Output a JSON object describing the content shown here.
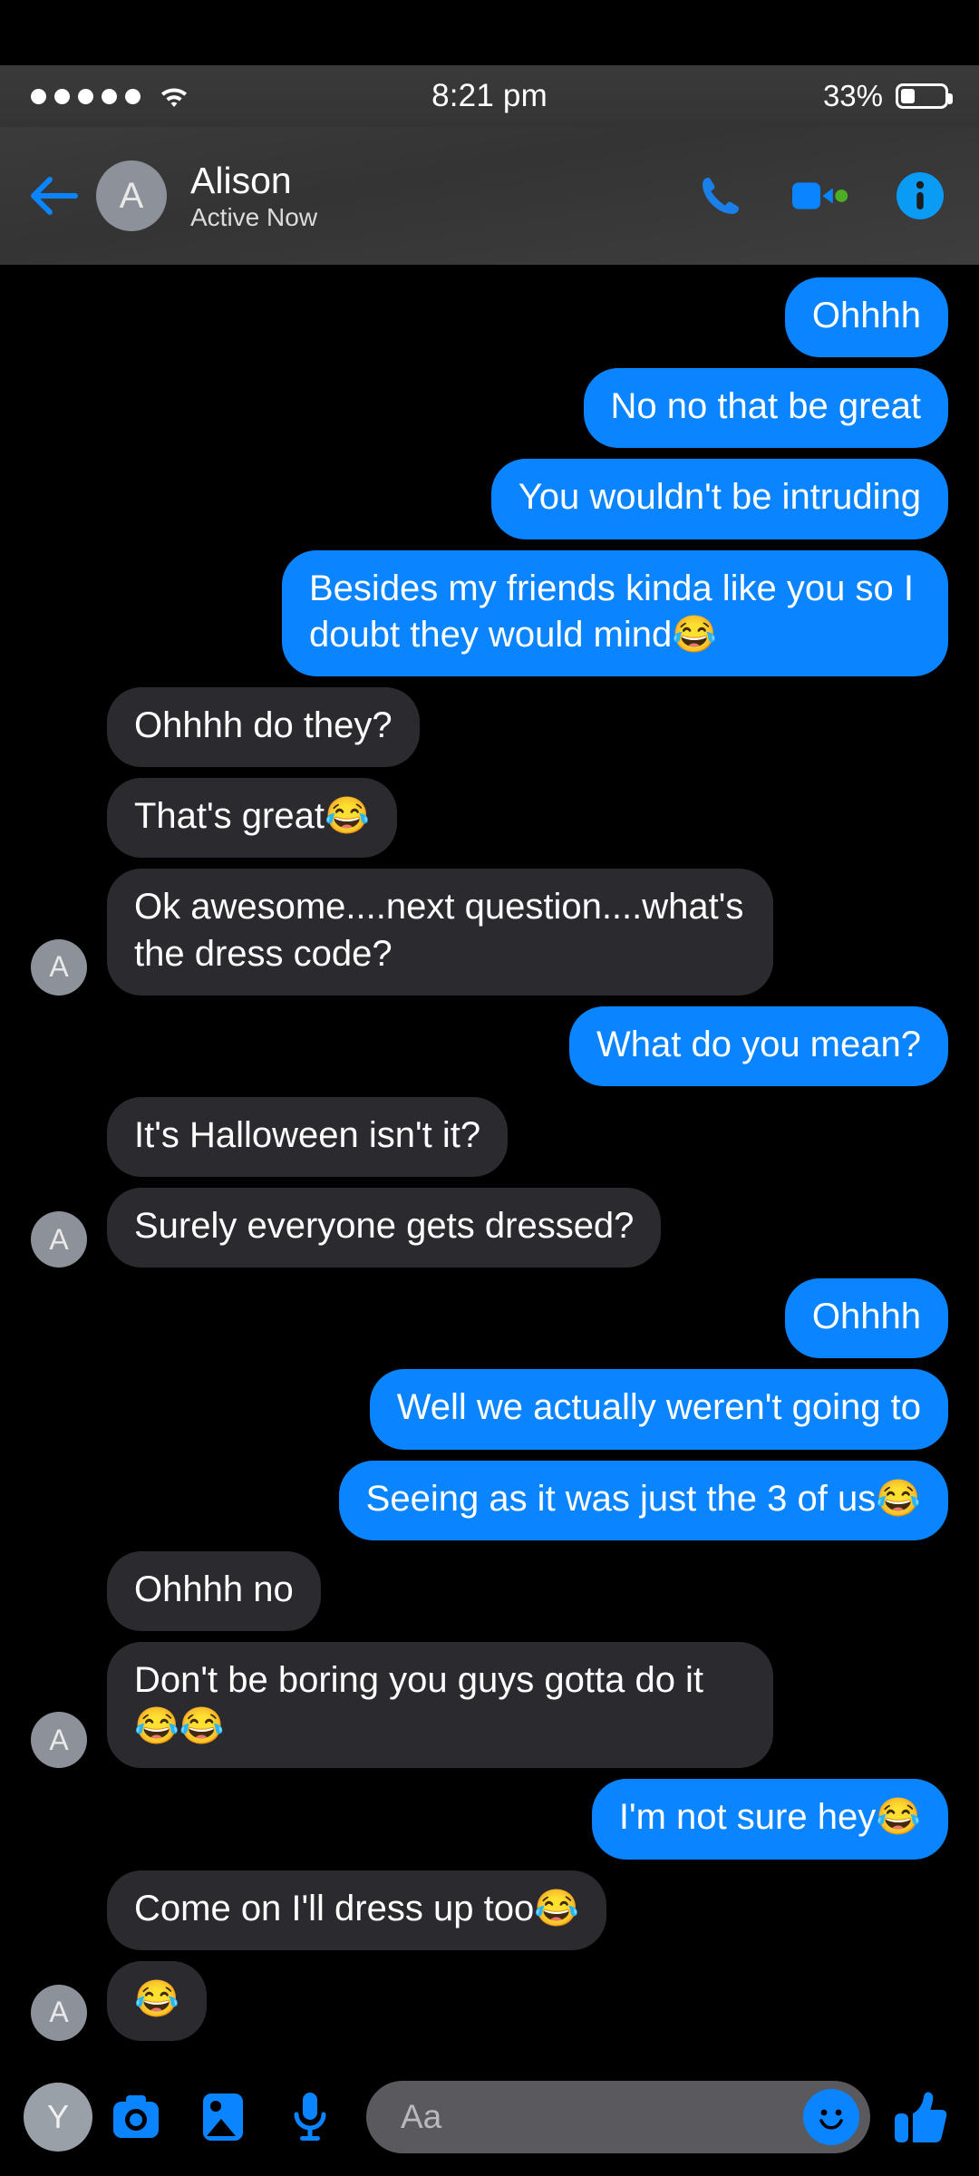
{
  "status_bar": {
    "signal_dots": 5,
    "wifi_icon": "wifi-icon",
    "time": "8:21 pm",
    "battery_percent": "33%",
    "battery_level": 33
  },
  "header": {
    "back_icon": "back-arrow-icon",
    "avatar_initial": "A",
    "title": "Alison",
    "subtitle": "Active Now",
    "actions": [
      {
        "name": "voice-call-icon",
        "label": "Voice call"
      },
      {
        "name": "video-call-icon",
        "label": "Video call"
      },
      {
        "name": "info-icon",
        "label": "Conversation info"
      }
    ],
    "active_dot_color": "#4caf23"
  },
  "colors": {
    "outgoing_bubble": "#0a84ff",
    "incoming_bubble": "#2b2b2f",
    "background": "#000000",
    "header_bg": "#3a3a3a",
    "avatar_bg": "#8d9199"
  },
  "messages": [
    {
      "side": "out",
      "text": "Ohhhh",
      "avatar": ""
    },
    {
      "side": "out",
      "text": "No no that be great",
      "avatar": ""
    },
    {
      "side": "out",
      "text": "You wouldn't be intruding",
      "avatar": ""
    },
    {
      "side": "out",
      "text": "Besides my friends kinda like you so I doubt they would mind😂",
      "avatar": ""
    },
    {
      "side": "in",
      "text": "Ohhhh do they?",
      "avatar": ""
    },
    {
      "side": "in",
      "text": "That's great😂",
      "avatar": ""
    },
    {
      "side": "in",
      "text": "Ok awesome....next question....what's the dress code?",
      "avatar": "A"
    },
    {
      "side": "out",
      "text": "What do you mean?",
      "avatar": ""
    },
    {
      "side": "in",
      "text": "It's Halloween isn't it?",
      "avatar": ""
    },
    {
      "side": "in",
      "text": "Surely everyone gets dressed?",
      "avatar": "A"
    },
    {
      "side": "out",
      "text": "Ohhhh",
      "avatar": ""
    },
    {
      "side": "out",
      "text": "Well we actually weren't going to",
      "avatar": ""
    },
    {
      "side": "out",
      "text": "Seeing as it was just the 3 of us😂",
      "avatar": ""
    },
    {
      "side": "in",
      "text": "Ohhhh no",
      "avatar": ""
    },
    {
      "side": "in",
      "text": "Don't be boring you guys gotta do it 😂😂",
      "avatar": "A"
    },
    {
      "side": "out",
      "text": "I'm not sure hey😂",
      "avatar": ""
    },
    {
      "side": "in",
      "text": "Come on I'll dress up too😂",
      "avatar": ""
    },
    {
      "side": "in",
      "text": "😂",
      "avatar": "A"
    }
  ],
  "composer": {
    "avatar_initial": "Y",
    "camera_icon": "camera-icon",
    "gallery_icon": "gallery-icon",
    "microphone_icon": "microphone-icon",
    "input_placeholder": "Aa",
    "input_value": "",
    "emoji_icon": "smiley-icon",
    "like_icon": "thumbs-up-icon"
  }
}
